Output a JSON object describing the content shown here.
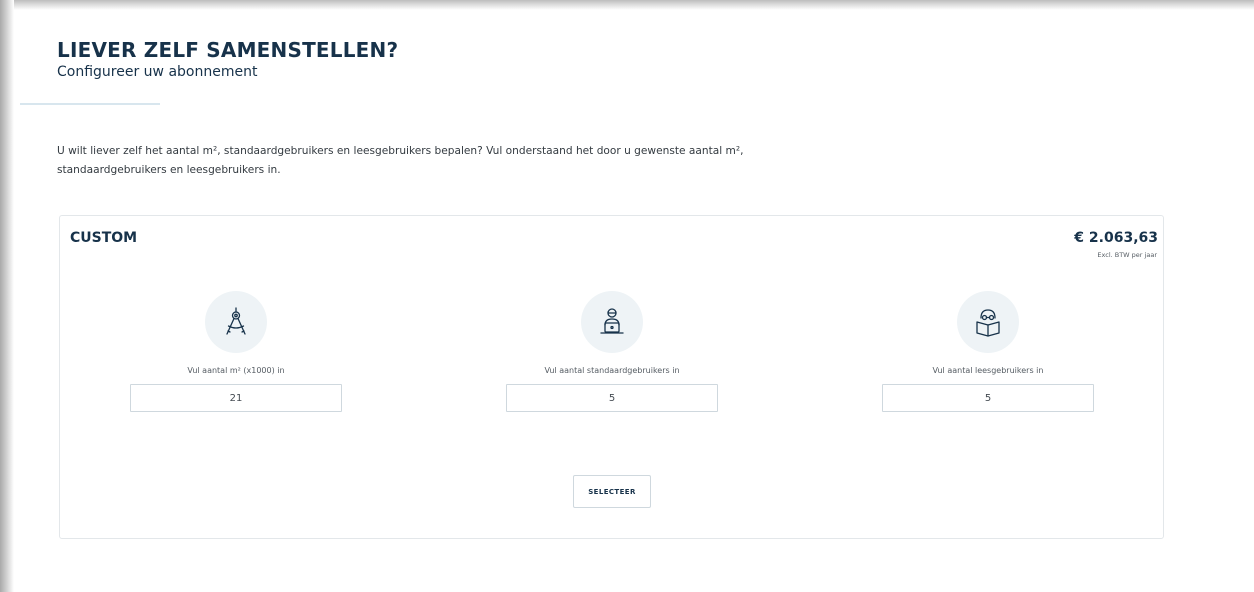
{
  "header": {
    "title": "LIEVER ZELF SAMENSTELLEN?",
    "subtitle": "Configureer uw abonnement"
  },
  "intro": {
    "text": "U wilt liever zelf het aantal m², standaardgebruikers en leesgebruikers bepalen? Vul onderstaand het door u gewenste aantal m², standaardgebruikers en leesgebruikers in."
  },
  "card": {
    "title": "CUSTOM",
    "price": "€ 2.063,63",
    "price_note": "Excl. BTW per jaar",
    "fields": [
      {
        "label": "Vul aantal m² (x1000) in",
        "value": "21",
        "icon": "compass-icon"
      },
      {
        "label": "Vul aantal standaardgebruikers in",
        "value": "5",
        "icon": "laptop-user-icon"
      },
      {
        "label": "Vul aantal leesgebruikers in",
        "value": "5",
        "icon": "reader-icon"
      }
    ],
    "select_label": "SELECTEER"
  },
  "colors": {
    "primary": "#17324a",
    "icon_bg": "#eef3f6",
    "border": "#cfd8de"
  }
}
